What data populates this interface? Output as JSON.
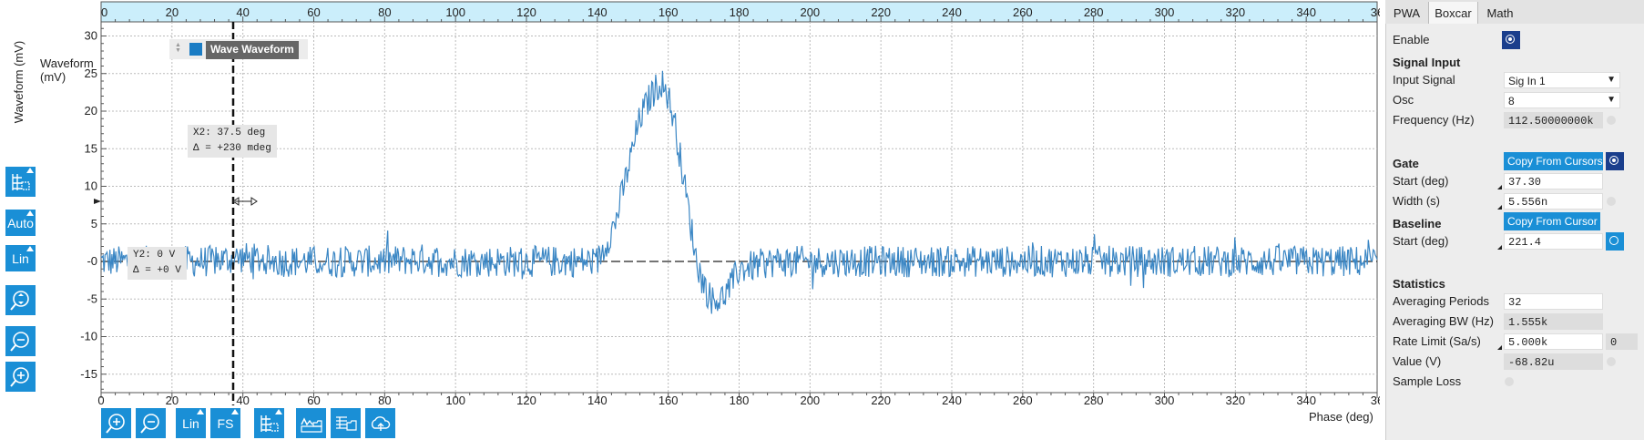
{
  "plot": {
    "y_axis_label": "Waveform (mV)",
    "x_axis_label": "Phase (deg)",
    "legend_label": "Wave Waveform",
    "top_ticks": [
      "0",
      "20",
      "40",
      "60",
      "80",
      "100",
      "120",
      "140",
      "160",
      "180",
      "200",
      "220",
      "240",
      "260",
      "280",
      "300",
      "320",
      "340",
      "36"
    ],
    "bottom_ticks": [
      "0",
      "20",
      "40",
      "60",
      "80",
      "100",
      "120",
      "140",
      "160",
      "180",
      "200",
      "220",
      "240",
      "260",
      "280",
      "300",
      "320",
      "340",
      "36"
    ],
    "y_ticks": [
      "30",
      "25",
      "20",
      "15",
      "10",
      "5",
      "-0",
      "-5",
      "-10",
      "-15"
    ],
    "cursor_x": {
      "line1": "X2: 37.5 deg",
      "line2": "Δ = +230 mdeg"
    },
    "cursor_y": {
      "line1": "Y2: 0 V",
      "line2": "Δ = +0 V"
    }
  },
  "chart_data": {
    "type": "line",
    "xlabel": "Phase (deg)",
    "ylabel": "Waveform (mV)",
    "xlim": [
      0,
      360
    ],
    "ylim": [
      -17,
      31
    ],
    "grid": true,
    "series": [
      {
        "name": "Wave Waveform",
        "color": "#3a86c4",
        "x": [
          0,
          10,
          20,
          30,
          40,
          50,
          60,
          70,
          80,
          90,
          100,
          110,
          120,
          130,
          140,
          145,
          150,
          152,
          155,
          158,
          160,
          162,
          165,
          168,
          170,
          172,
          175,
          178,
          180,
          190,
          200,
          220,
          240,
          260,
          280,
          300,
          320,
          340,
          360
        ],
        "y": [
          0,
          0,
          0,
          0,
          0.5,
          0,
          0,
          0,
          0,
          0.3,
          0,
          0,
          0,
          0,
          0,
          5,
          15,
          19,
          22,
          24,
          22,
          18,
          9,
          0,
          -3,
          -5,
          -5,
          -3,
          -1,
          0,
          0,
          0,
          0,
          0,
          0,
          0,
          0,
          0,
          0
        ]
      }
    ],
    "markers": {
      "x_cursor": 37.5,
      "y_cursor": 0
    }
  },
  "left_toolbar": {
    "auto_label": "Auto",
    "lin_label": "Lin"
  },
  "bottom_toolbar": {
    "lin_label": "Lin",
    "fs_label": "FS"
  },
  "tabs": [
    {
      "label": "PWA",
      "active": false
    },
    {
      "label": "Boxcar",
      "active": true
    },
    {
      "label": "Math",
      "active": false
    }
  ],
  "panel": {
    "enable_label": "Enable",
    "signal_input_heading": "Signal Input",
    "input_signal_label": "Input Signal",
    "input_signal_value": "Sig In 1",
    "osc_label": "Osc",
    "osc_value": "8",
    "frequency_label": "Frequency (Hz)",
    "frequency_value": "112.50000000k",
    "gate_heading": "Gate",
    "copy_from_cursors_label": "Copy From Cursors",
    "gate_start_label": "Start (deg)",
    "gate_start_value": "37.30",
    "gate_width_label": "Width (s)",
    "gate_width_value": "5.556n",
    "baseline_heading": "Baseline",
    "copy_from_cursor_label": "Copy From Cursor",
    "baseline_start_label": "Start (deg)",
    "baseline_start_value": "221.4",
    "statistics_heading": "Statistics",
    "avg_periods_label": "Averaging Periods",
    "avg_periods_value": "32",
    "avg_bw_label": "Averaging BW (Hz)",
    "avg_bw_value": "1.555k",
    "rate_limit_label": "Rate Limit (Sa/s)",
    "rate_limit_value": "5.000k",
    "rate_limit_extra": "0",
    "value_label": "Value (V)",
    "value_value": "-68.82u",
    "sample_loss_label": "Sample Loss"
  },
  "colors": {
    "accent": "#1a8fd6",
    "dark_button": "#1a3e8c",
    "trace": "#3a86c4",
    "axis_bar": "#cbeefb"
  }
}
